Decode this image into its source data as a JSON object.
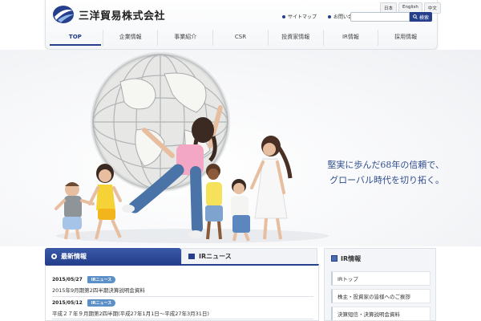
{
  "brand": {
    "name": "三洋貿易株式会社",
    "color": "#253f8c"
  },
  "language_buttons": [
    "日本",
    "English",
    "中文"
  ],
  "utility_links": [
    "サイトマップ",
    "お問い合わせ"
  ],
  "search": {
    "placeholder": "",
    "button_label": "検索",
    "icon": "search-icon"
  },
  "nav": {
    "items": [
      "TOP",
      "企業情報",
      "事業紹介",
      "CSR",
      "投資家情報",
      "IR情報",
      "採用情報"
    ]
  },
  "hero": {
    "tagline": [
      "堅実に歩んだ68年の信頼で、",
      "グローバル時代を切り拓く。"
    ]
  },
  "news": {
    "tabs": [
      "最新情報",
      "IRニュース"
    ],
    "items": [
      {
        "date": "2015/05/27",
        "badge": "IRニュース",
        "title": "2015年9月期第2四半期決算説明会資料"
      },
      {
        "date": "2015/05/12",
        "badge": "IRニュース",
        "title": "平成２７年９月期第2四半期(平成27年1月1日～平成27年3月31日)"
      }
    ]
  },
  "ir": {
    "heading": "IR情報",
    "links": [
      "IRトップ",
      "株主・投資家の皆様へのご挨拶",
      "決算短信・決算説明会資料"
    ]
  }
}
